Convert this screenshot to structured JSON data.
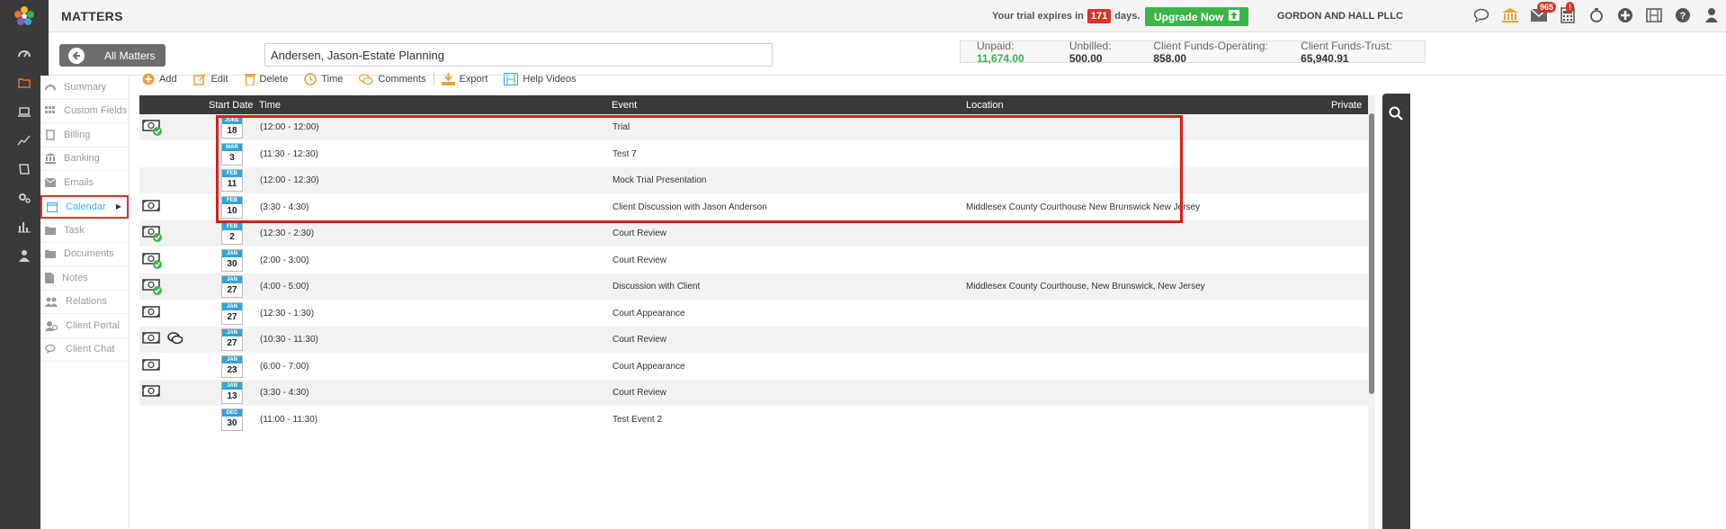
{
  "header": {
    "title": "MATTERS",
    "trial_prefix": "Your trial expires in",
    "trial_days": "171",
    "trial_suffix": "days.",
    "upgrade_label": "Upgrade Now",
    "company": "GORDON AND HALL PLLC",
    "mail_badge": "965",
    "calendar_badge": "!"
  },
  "subbar": {
    "all_matters_label": "All Matters",
    "matter_name": "Andersen, Jason-Estate Planning",
    "balances": [
      {
        "label": "Unpaid:",
        "value": "11,674.00"
      },
      {
        "label": "Unbilled:",
        "value": "500.00"
      },
      {
        "label": "Client Funds-Operating:",
        "value": "858.00"
      },
      {
        "label": "Client Funds-Trust:",
        "value": "65,940.91"
      }
    ]
  },
  "sidemenu": {
    "items": [
      {
        "label": "Summary",
        "icon": "dashboard-icon"
      },
      {
        "label": "Custom Fields",
        "icon": "grid-icon"
      },
      {
        "label": "Billing",
        "icon": "billing-icon"
      },
      {
        "label": "Banking",
        "icon": "bank-icon"
      },
      {
        "label": "Emails",
        "icon": "envelope-icon"
      },
      {
        "label": "Calendar",
        "icon": "calendar-icon"
      },
      {
        "label": "Task",
        "icon": "folder-icon"
      },
      {
        "label": "Documents",
        "icon": "folder-icon"
      },
      {
        "label": "Notes",
        "icon": "note-icon"
      },
      {
        "label": "Relations",
        "icon": "users-icon"
      },
      {
        "label": "Client Portal",
        "icon": "portal-icon"
      },
      {
        "label": "Client Chat",
        "icon": "chat-icon"
      }
    ]
  },
  "toolbar": {
    "add": "Add",
    "edit": "Edit",
    "delete": "Delete",
    "time": "Time",
    "comments": "Comments",
    "export": "Export",
    "help": "Help Videos"
  },
  "table": {
    "headers": {
      "start_date": "Start Date",
      "time": "Time",
      "event": "Event",
      "location": "Location",
      "private": "Private"
    },
    "rows": [
      {
        "mon": "JUNE",
        "day": "18",
        "time": "(12:00 - 12:00)",
        "event": "Trial",
        "location": "",
        "billed": true,
        "check": true,
        "comment": false
      },
      {
        "mon": "MAR",
        "day": "3",
        "time": "(11:30 - 12:30)",
        "event": "Test 7",
        "location": "",
        "billed": false,
        "check": false,
        "comment": false
      },
      {
        "mon": "FEB",
        "day": "11",
        "time": "(12:00 - 12:30)",
        "event": "Mock Trial Presentation",
        "location": "",
        "billed": false,
        "check": false,
        "comment": false
      },
      {
        "mon": "FEB",
        "day": "10",
        "time": "(3:30 - 4:30)",
        "event": "Client Discussion with Jason Anderson",
        "location": "Middlesex County Courthouse New Brunswick New Jersey",
        "billed": true,
        "check": false,
        "comment": false
      },
      {
        "mon": "FEB",
        "day": "2",
        "time": "(12:30 - 2:30)",
        "event": "Court Review",
        "location": "",
        "billed": true,
        "check": true,
        "comment": false
      },
      {
        "mon": "JAN",
        "day": "30",
        "time": "(2:00 - 3:00)",
        "event": "Court Review",
        "location": "",
        "billed": true,
        "check": true,
        "comment": false
      },
      {
        "mon": "JAN",
        "day": "27",
        "time": "(4:00 - 5:00)",
        "event": "Discussion with Client",
        "location": "Middlesex County Courthouse, New Brunswick, New Jersey",
        "billed": true,
        "check": true,
        "comment": false
      },
      {
        "mon": "JAN",
        "day": "27",
        "time": "(12:30 - 1:30)",
        "event": "Court Appearance",
        "location": "",
        "billed": true,
        "check": false,
        "comment": false
      },
      {
        "mon": "JAN",
        "day": "27",
        "time": "(10:30 - 11:30)",
        "event": "Court Review",
        "location": "",
        "billed": true,
        "check": false,
        "comment": true
      },
      {
        "mon": "JAN",
        "day": "23",
        "time": "(6:00 - 7:00)",
        "event": "Court Appearance",
        "location": "",
        "billed": true,
        "check": false,
        "comment": false
      },
      {
        "mon": "JAN",
        "day": "13",
        "time": "(3:30 - 4:30)",
        "event": "Court Review",
        "location": "",
        "billed": true,
        "check": false,
        "comment": false
      },
      {
        "mon": "DEC",
        "day": "30",
        "time": "(11:00 - 11:30)",
        "event": "Test Event 2",
        "location": "",
        "billed": false,
        "check": false,
        "comment": false
      }
    ]
  },
  "colors": {
    "accent": "#3aaee0",
    "orange": "#e8703a",
    "green": "#3bb44a",
    "red": "#d9352a",
    "dark": "#3a3a3a"
  }
}
